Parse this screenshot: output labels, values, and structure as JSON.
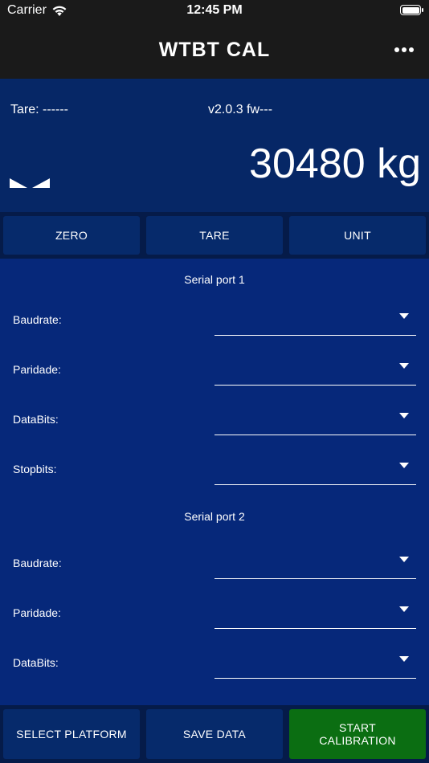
{
  "status_bar": {
    "carrier": "Carrier",
    "time": "12:45 PM"
  },
  "nav": {
    "title": "WTBT CAL",
    "menu_icon": "more-horizontal-icon"
  },
  "weight_panel": {
    "tare": "Tare: ------",
    "version": "v2.0.3 fw---",
    "weight": "30480 kg",
    "stable_icon": "stability-indicator-icon"
  },
  "actions": {
    "zero": "ZERO",
    "tare": "TARE",
    "unit": "UNIT"
  },
  "serial_port_1": {
    "title": "Serial port 1",
    "fields": [
      {
        "label": "Baudrate:",
        "value": ""
      },
      {
        "label": "Paridade:",
        "value": ""
      },
      {
        "label": "DataBits:",
        "value": ""
      },
      {
        "label": "Stopbits:",
        "value": ""
      }
    ]
  },
  "serial_port_2": {
    "title": "Serial port 2",
    "fields": [
      {
        "label": "Baudrate:",
        "value": ""
      },
      {
        "label": "Paridade:",
        "value": ""
      },
      {
        "label": "DataBits:",
        "value": ""
      }
    ]
  },
  "bottom": {
    "select_platform": "SELECT PLATFORM",
    "save_data": "SAVE DATA",
    "start_calibration": "START\nCALIBRATION"
  },
  "colors": {
    "nav_bg": "#1a1a1a",
    "panel_bg": "#062766",
    "settings_bg": "#06287a",
    "button_bg": "#062a6b",
    "start_button": "#0b6e12"
  }
}
